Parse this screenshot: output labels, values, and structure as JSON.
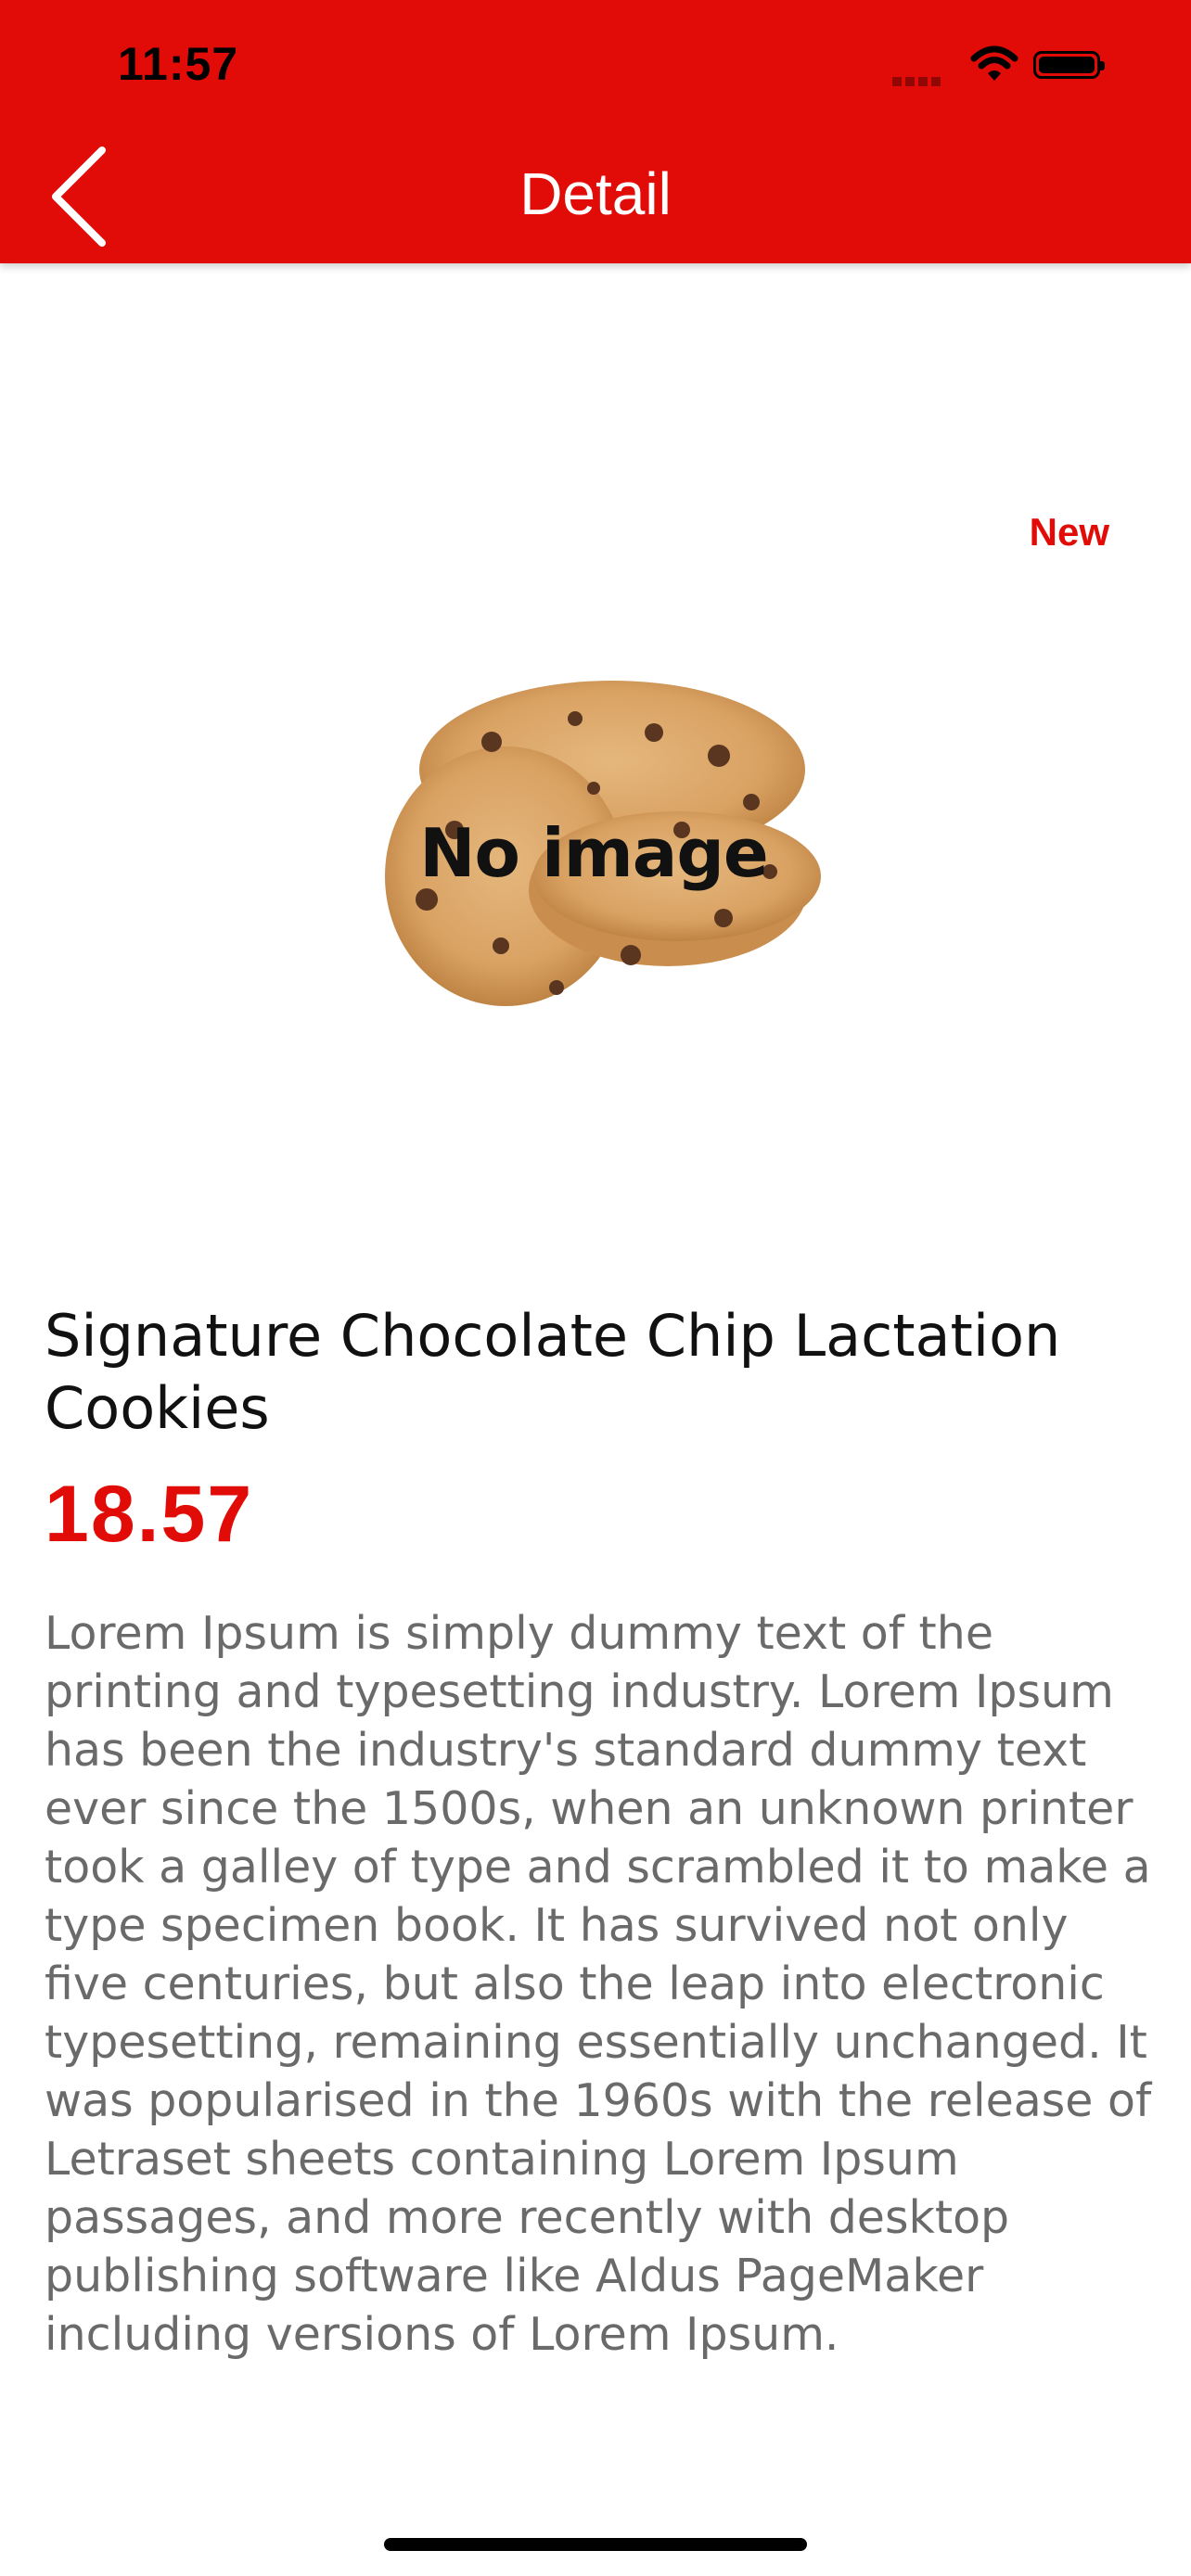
{
  "status_bar": {
    "time": "11:57",
    "icons": [
      "signal-icon",
      "wifi-icon",
      "battery-icon"
    ]
  },
  "app_bar": {
    "title": "Detail",
    "back_icon": "chevron-left-icon",
    "background_color": "#e10c07"
  },
  "product": {
    "badge": "New",
    "image_label": "No image",
    "name": "Signature Chocolate Chip Lactation Cookies",
    "price": "18.57",
    "description": "Lorem Ipsum is simply dummy text of the printing and typesetting industry. Lorem Ipsum has been the industry's standard dummy text ever since the 1500s, when an unknown printer took a galley of type and scrambled it to make a type specimen book. It has survived not only five centuries, but also the leap into electronic typesetting, remaining essentially unchanged. It was popularised in the 1960s with the release of Letraset sheets containing Lorem Ipsum passages, and more recently with desktop publishing software like Aldus PageMaker including versions of Lorem Ipsum."
  },
  "colors": {
    "accent": "#e10c07",
    "text_primary": "#111111",
    "text_secondary": "#6a6a6a"
  }
}
